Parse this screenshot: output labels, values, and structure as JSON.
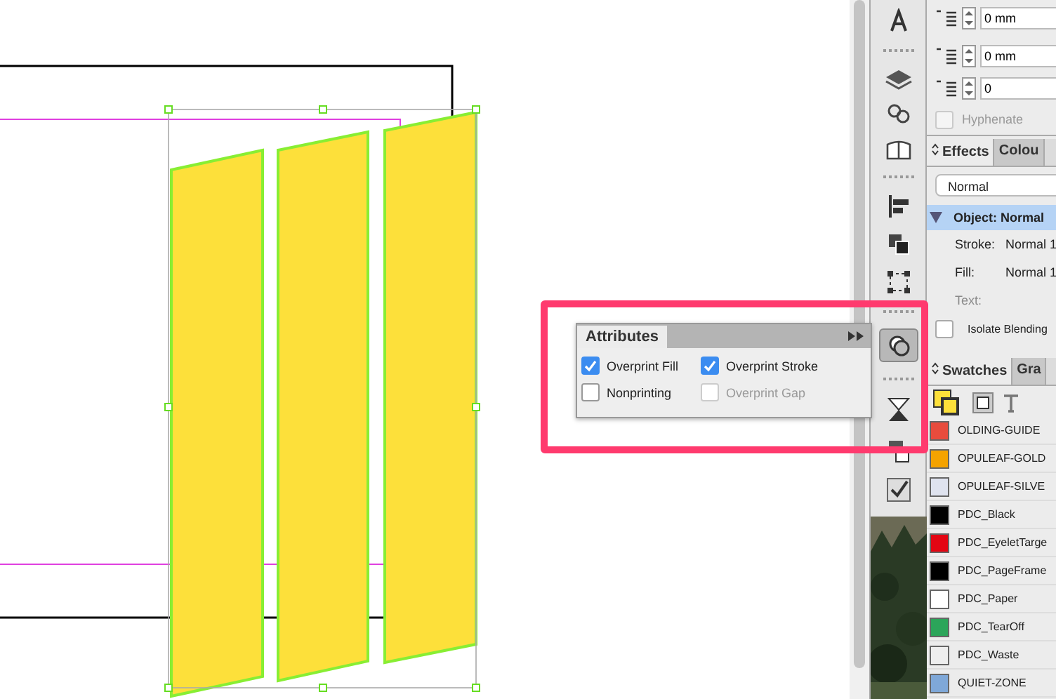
{
  "paragraph_panel": {
    "fields": [
      {
        "value": "0 mm"
      },
      {
        "value": "0 mm"
      },
      {
        "value": "0"
      }
    ],
    "hyphenate": {
      "label": "Hyphenate",
      "checked": false,
      "disabled": true
    }
  },
  "effects_panel": {
    "tabs": [
      {
        "label": "Effects",
        "selected": true
      },
      {
        "label": "Colou",
        "selected": false
      }
    ],
    "blend_mode": "Normal",
    "object_row": {
      "label": "Object: Normal",
      "expanded": true
    },
    "rows": [
      {
        "label": "Stroke:",
        "value": "Normal 1",
        "disabled": false
      },
      {
        "label": "Fill:",
        "value": "Normal 1",
        "disabled": false
      },
      {
        "label": "Text:",
        "disabled": true
      }
    ],
    "isolate_blending": {
      "label": "Isolate Blending",
      "checked": false
    }
  },
  "swatches_panel": {
    "tabs": [
      {
        "label": "Swatches",
        "selected": true
      },
      {
        "label": "Gra",
        "selected": false
      }
    ],
    "swatches": [
      {
        "name": "OLDING-GUIDE",
        "color": "#e84c3d"
      },
      {
        "name": "OPULEAF-GOLD",
        "color": "#f5a300"
      },
      {
        "name": "OPULEAF-SILVE",
        "color": "#dfe3ef"
      },
      {
        "name": "PDC_Black",
        "color": "#000000"
      },
      {
        "name": "PDC_EyeletTarge",
        "color": "#e30613"
      },
      {
        "name": "PDC_PageFrame",
        "color": "#000000"
      },
      {
        "name": "PDC_Paper",
        "color": "#ffffff"
      },
      {
        "name": "PDC_TearOff",
        "color": "#2ca55a"
      },
      {
        "name": "PDC_Waste",
        "color": "#eeeeee"
      },
      {
        "name": "QUIET-ZONE",
        "color": "#7fa8d8"
      }
    ]
  },
  "attributes_panel": {
    "title": "Attributes",
    "options": [
      {
        "label": "Overprint Fill",
        "checked": true,
        "disabled": false
      },
      {
        "label": "Overprint Stroke",
        "checked": true,
        "disabled": false
      },
      {
        "label": "Nonprinting",
        "checked": false,
        "disabled": false
      },
      {
        "label": "Overprint Gap",
        "checked": false,
        "disabled": true
      }
    ]
  }
}
